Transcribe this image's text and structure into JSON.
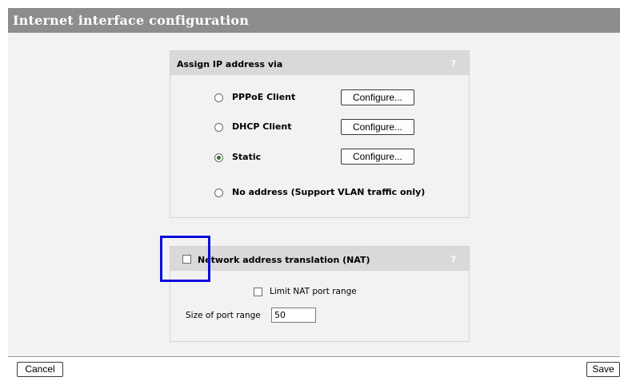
{
  "page": {
    "title": "Internet interface configuration"
  },
  "assign_panel": {
    "title": "Assign IP address via",
    "help": "?",
    "options": [
      {
        "label": "PPPoE Client",
        "selected": false,
        "button": "Configure..."
      },
      {
        "label": "DHCP Client",
        "selected": false,
        "button": "Configure..."
      },
      {
        "label": "Static",
        "selected": true,
        "button": "Configure..."
      },
      {
        "label": "No address (Support VLAN traffic only)",
        "selected": false
      }
    ]
  },
  "nat_panel": {
    "title": "Network address translation (NAT)",
    "help": "?",
    "enabled": false,
    "limit_port_range_label": "Limit NAT port range",
    "limit_port_range_checked": false,
    "port_range_size_label": "Size of port range",
    "port_range_size_value": "50"
  },
  "footer": {
    "cancel_label": "Cancel",
    "save_label": "Save"
  },
  "colors": {
    "title_bar": "#8d8d8d",
    "panel_header": "#d9d9d9",
    "content_background": "#f2f2f2",
    "highlight_box": "#0a0adc"
  }
}
